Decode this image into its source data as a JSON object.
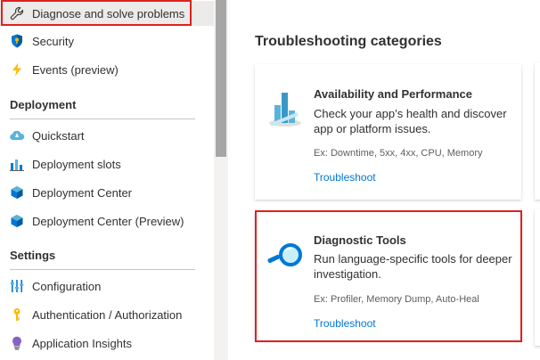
{
  "sidebar": {
    "top_items": [
      {
        "label": "Diagnose and solve problems",
        "icon": "wrench-icon",
        "selected": true
      },
      {
        "label": "Security",
        "icon": "shield-icon"
      },
      {
        "label": "Events (preview)",
        "icon": "lightning-icon"
      }
    ],
    "deployment": {
      "header": "Deployment",
      "items": [
        {
          "label": "Quickstart",
          "icon": "cloud-icon"
        },
        {
          "label": "Deployment slots",
          "icon": "deployment-slots-icon"
        },
        {
          "label": "Deployment Center",
          "icon": "cube-icon"
        },
        {
          "label": "Deployment Center (Preview)",
          "icon": "cube-icon"
        }
      ]
    },
    "settings": {
      "header": "Settings",
      "items": [
        {
          "label": "Configuration",
          "icon": "sliders-icon"
        },
        {
          "label": "Authentication / Authorization",
          "icon": "key-icon"
        },
        {
          "label": "Application Insights",
          "icon": "lightbulb-icon"
        }
      ]
    }
  },
  "main": {
    "title": "Troubleshooting categories",
    "cards": [
      {
        "title": "Availability and Performance",
        "description": "Check your app’s health and discover app or platform issues.",
        "example": "Ex: Downtime, 5xx, 4xx, CPU, Memory",
        "link": "Troubleshoot",
        "icon": "bar-chart-icon"
      },
      {
        "title": "Diagnostic Tools",
        "description": "Run language-specific tools for deeper investigation.",
        "example": "Ex: Profiler, Memory Dump, Auto-Heal",
        "link": "Troubleshoot",
        "icon": "magnifier-icon"
      }
    ]
  },
  "colors": {
    "highlight": "#e02020",
    "link": "#0078d4",
    "selected_bg": "#edebe9"
  }
}
